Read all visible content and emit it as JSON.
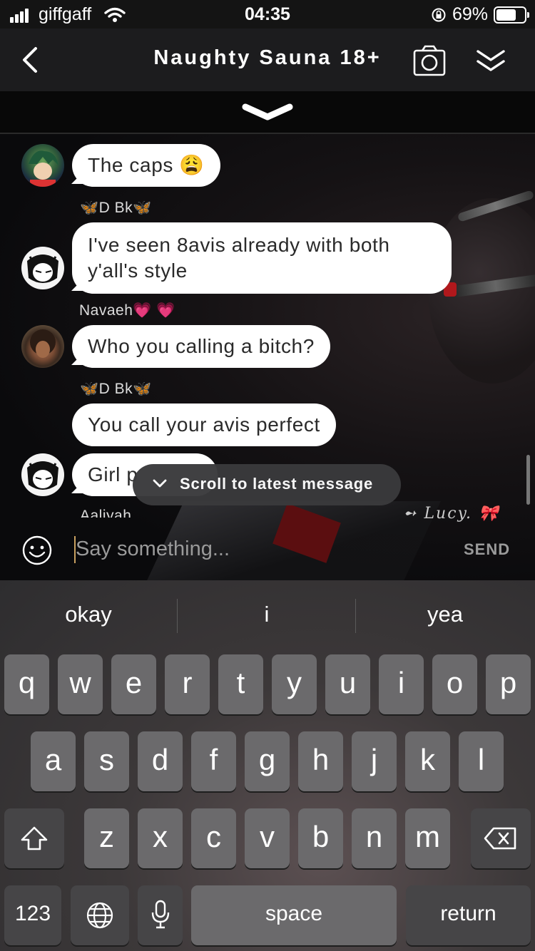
{
  "status": {
    "carrier": "giffgaff",
    "time": "04:35",
    "battery": "69%"
  },
  "header": {
    "title": "Naughty Sauna 18+"
  },
  "messages": [
    {
      "text": "The caps 😩"
    },
    {
      "sender": "D Bk",
      "text_line1": "I've seen 8avis already with both",
      "text_line2": "y'all's style"
    },
    {
      "sender": "Navaeh",
      "text": "Who you calling a bitch?"
    },
    {
      "sender": "D Bk",
      "text": "You call your avis perfect"
    },
    {
      "text": "Girl p"
    }
  ],
  "cut_sender": "Aaliyah",
  "toast": {
    "label": "Scroll to latest message"
  },
  "watermark": "Lucy.",
  "input": {
    "placeholder": "Say something...",
    "send": "SEND"
  },
  "keyboard": {
    "suggestions": [
      "okay",
      "i",
      "yea"
    ],
    "row1": [
      "q",
      "w",
      "e",
      "r",
      "t",
      "y",
      "u",
      "i",
      "o",
      "p"
    ],
    "row2": [
      "a",
      "s",
      "d",
      "f",
      "g",
      "h",
      "j",
      "k",
      "l"
    ],
    "row3": [
      "z",
      "x",
      "c",
      "v",
      "b",
      "n",
      "m"
    ],
    "numbers_label": "123",
    "space_label": "space",
    "return_label": "return"
  },
  "colors": {
    "accent_blue": "#3d9be9",
    "heart_pink": "#ff5fb8",
    "bubble": "#ffffff"
  }
}
